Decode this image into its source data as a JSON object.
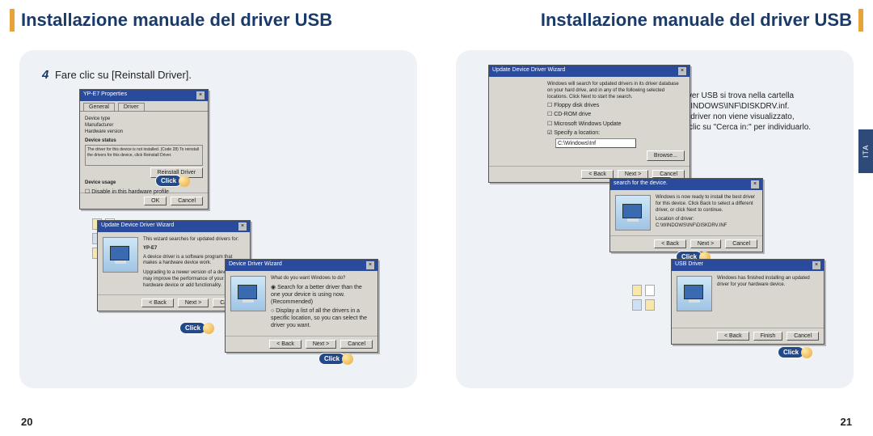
{
  "page_left": {
    "title": "Installazione manuale del driver USB",
    "number": "20",
    "step_number": "4",
    "step_text": "Fare clic su [Reinstall Driver].",
    "click_label": "Click",
    "dialogs": {
      "properties": {
        "title": "YP-E7   Properties",
        "tab_general": "General",
        "tab_driver": "Driver",
        "label_device_type": "Device type",
        "label_manufacturer": "Manufacturer",
        "label_hardware": "Hardware version",
        "status_heading": "Device status",
        "status_text": "The driver for this device is not installed. (Code 28) To reinstall the drivers for this device, click Reinstall Driver.",
        "btn_reinstall": "Reinstall Driver",
        "usage_heading": "Device usage",
        "usage_option": "Disable in this hardware profile",
        "btn_ok": "OK",
        "btn_cancel": "Cancel"
      },
      "wizard1": {
        "title": "Update Device Driver Wizard",
        "line1": "This wizard searches for updated drivers for:",
        "device": "YP-E7",
        "line2": "A device driver is a software program that makes a hardware device work.",
        "line3": "Upgrading to a newer version of a device driver may improve the performance of your hardware device or add functionality.",
        "btn_back": "< Back",
        "btn_next": "Next >",
        "btn_cancel": "Cancel"
      },
      "wizard2": {
        "title": "Device Driver Wizard",
        "prompt": "What do you want Windows to do?",
        "opt1": "Search for a better driver than the one your device is using now. (Recommended)",
        "opt2": "Display a list of all the drivers in a specific location, so you can select the driver you want.",
        "btn_back": "< Back",
        "btn_next": "Next >",
        "btn_cancel": "Cancel"
      }
    }
  },
  "page_right": {
    "title": "Installazione manuale del driver USB",
    "number": "21",
    "side_tab": "ITA",
    "click_label": "Click",
    "note": {
      "l1": "Il driver USB si trova nella cartella",
      "l2": "C:\\WINDOWS\\INF\\DISKDRV.inf.",
      "l3": "Se il driver non viene visualizzato,",
      "l4": "fare clic su \"Cerca in:\" per individuarlo."
    },
    "dialogs": {
      "wizard_locate": {
        "title": "Update Device Driver Wizard",
        "intro": "Windows will search for updated drivers in its driver database on your hard drive, and in any of the following selected locations. Click Next to start the search.",
        "chk_floppy": "Floppy disk drives",
        "chk_cdrom": "CD-ROM drive",
        "chk_windowsupdate": "Microsoft Windows Update",
        "chk_specify": "Specify a location:",
        "path_value": "C:\\Windows\\Inf",
        "btn_browse": "Browse...",
        "btn_back": "< Back",
        "btn_next": "Next >",
        "btn_cancel": "Cancel"
      },
      "wizard_found": {
        "title_fragment": "search for the device.",
        "line1": "Windows is now ready to install the best driver for this device. Click Back to select a different driver, or click Next to continue.",
        "loc_heading": "Location of driver:",
        "loc_value": "C:\\WINDOWS\\INF\\DISKDRV.INF",
        "btn_back": "< Back",
        "btn_next": "Next >",
        "btn_cancel": "Cancel"
      },
      "wizard_finish": {
        "title_fragment": "USB Driver",
        "line1": "Windows has finished installing an updated driver for your hardware device.",
        "btn_back": "< Back",
        "btn_finish": "Finish",
        "btn_cancel": "Cancel"
      }
    }
  }
}
